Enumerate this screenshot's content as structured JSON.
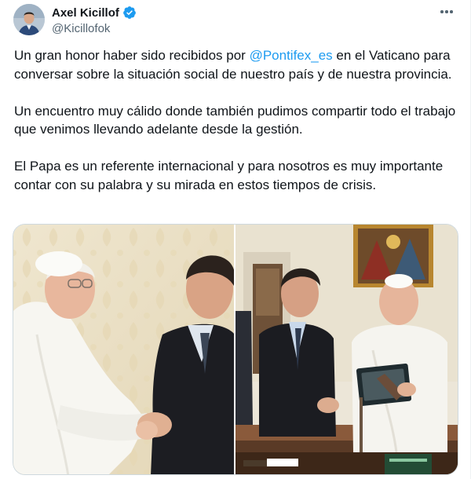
{
  "author": {
    "display_name": "Axel Kicillof",
    "handle": "@Kicillofok",
    "verified_color": "#1d9bf0",
    "avatar_icon": "user-avatar"
  },
  "menu": {
    "icon": "more-horizontal-icon"
  },
  "tweet": {
    "p1_before": "Un gran honor haber sido recibidos por ",
    "p1_mention": "@Pontifex_es",
    "p1_after": " en el Vaticano para conversar sobre la situación social de nuestro país y de nuestra provincia.",
    "p2": "Un encuentro muy cálido donde también pudimos compartir todo el trabajo que venimos llevando adelante desde la gestión.",
    "p3": "El Papa es un referente internacional y para nosotros es muy importante contar con su palabra y su mirada en estos tiempos de crisis."
  },
  "colors": {
    "text": "#0f1419",
    "secondary": "#536471",
    "link": "#1d9bf0",
    "border": "#cfd9de"
  }
}
